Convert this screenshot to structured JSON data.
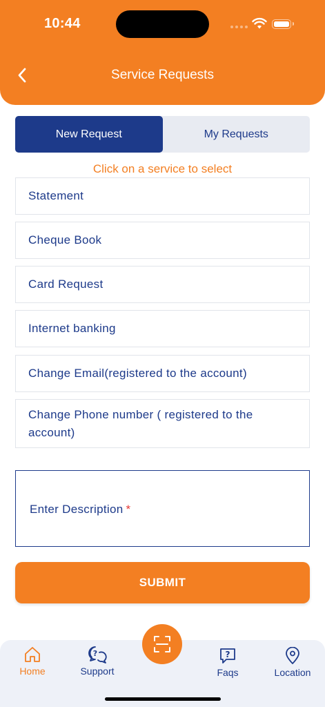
{
  "status_bar": {
    "time": "10:44"
  },
  "header": {
    "title": "Service Requests",
    "back_icon": "chevron-left-icon"
  },
  "tabs": [
    {
      "label": "New Request",
      "active": true
    },
    {
      "label": "My Requests",
      "active": false
    }
  ],
  "hint": "Click on a service to select",
  "services": [
    {
      "label": "Statement"
    },
    {
      "label": "Cheque Book"
    },
    {
      "label": "Card Request"
    },
    {
      "label": "Internet banking"
    },
    {
      "label": "Change Email(registered to the account)"
    },
    {
      "label": "Change Phone number ( registered to the account)"
    }
  ],
  "description": {
    "label": "Enter Description",
    "required_mark": "*"
  },
  "submit": {
    "label": "SUBMIT"
  },
  "bottom_nav": {
    "items": [
      {
        "label": "Home",
        "icon": "home-icon",
        "active": true
      },
      {
        "label": "Support",
        "icon": "support-chat-icon",
        "active": false
      },
      {
        "label": "Faqs",
        "icon": "faq-icon",
        "active": false
      },
      {
        "label": "Location",
        "icon": "location-pin-icon",
        "active": false
      }
    ],
    "center_icon": "scan-icon"
  },
  "colors": {
    "primary": "#F37F22",
    "navy": "#1D3A8A",
    "tab_bg": "#E8EBF2",
    "nav_bg": "#EEF1F8",
    "required": "#E53935"
  }
}
